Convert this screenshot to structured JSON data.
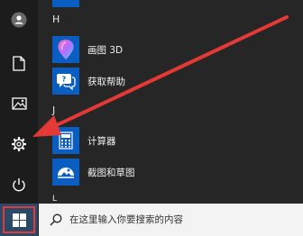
{
  "start_menu": {
    "sections": [
      {
        "letter": "H",
        "apps": [
          {
            "label": "画图 3D",
            "icon": "paint3d-icon"
          },
          {
            "label": "获取帮助",
            "icon": "get-help-icon"
          }
        ]
      },
      {
        "letter": "J",
        "apps": [
          {
            "label": "计算器",
            "icon": "calculator-icon"
          },
          {
            "label": "截图和草图",
            "icon": "snip-sketch-icon"
          }
        ]
      },
      {
        "letter": "L",
        "apps": []
      }
    ],
    "rail": [
      "user-icon",
      "document-icon",
      "pictures-icon",
      "settings-icon",
      "power-icon"
    ]
  },
  "taskbar": {
    "search_placeholder": "在这里输入你要搜索的内容",
    "start_icon": "windows-logo-icon"
  },
  "annotation": {
    "arrow_color": "#e53935",
    "highlight_color": "#e53935"
  }
}
